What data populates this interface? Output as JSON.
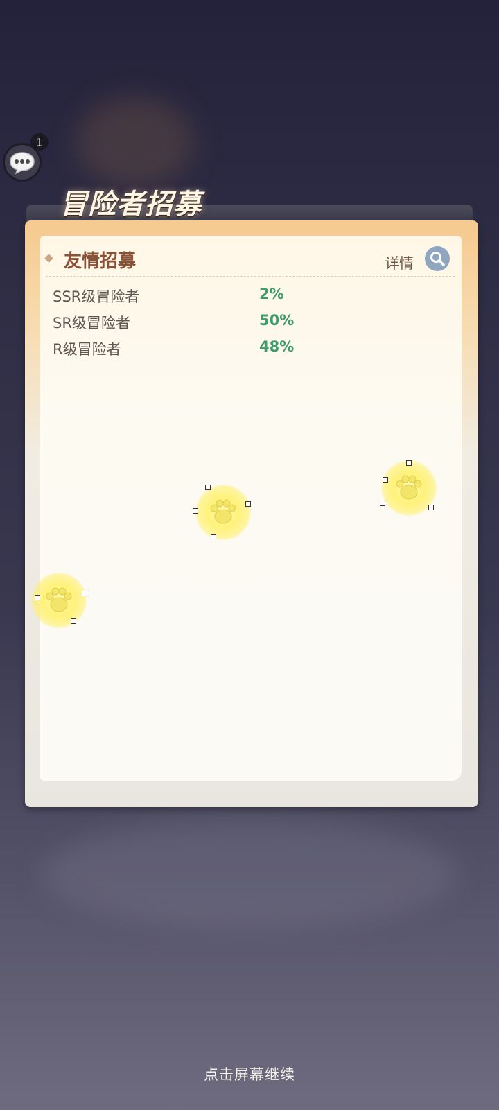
{
  "chat": {
    "badge_count": "1",
    "icon": "chat-bubble-icon"
  },
  "header": {
    "title": "冒险者招募"
  },
  "panel": {
    "section_title": "友情招募",
    "detail_label": "详情",
    "detail_icon": "search-icon",
    "rates": [
      {
        "name": "SSR级冒险者",
        "value": "2%"
      },
      {
        "name": "SR级冒险者",
        "value": "50%"
      },
      {
        "name": "R级冒险者",
        "value": "48%"
      }
    ]
  },
  "footer": {
    "continue_text": "点击屏幕继续"
  }
}
